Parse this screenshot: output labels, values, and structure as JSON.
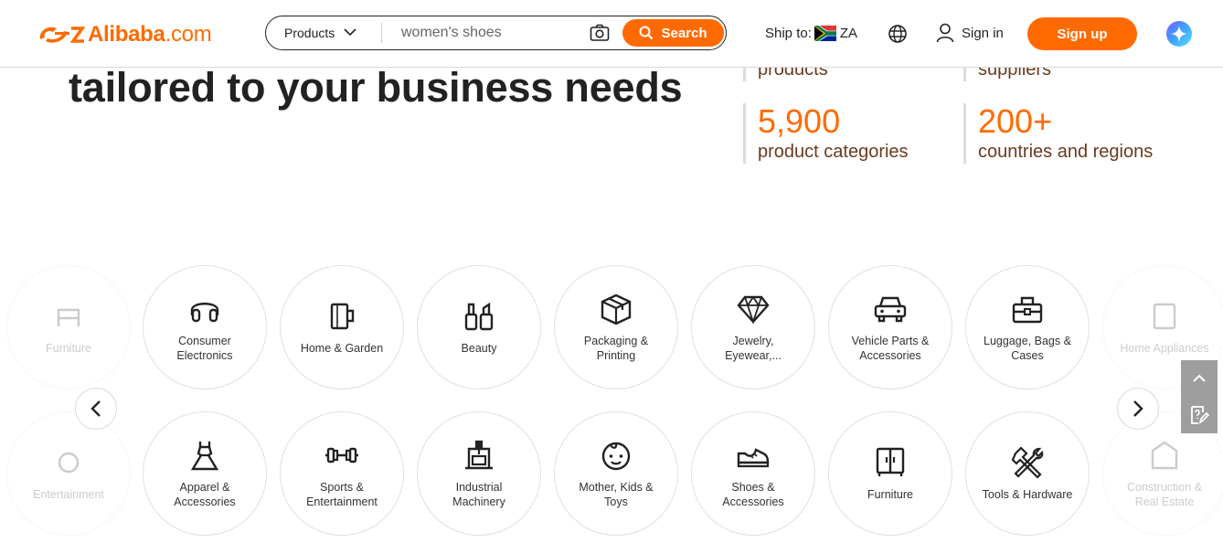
{
  "header": {
    "logo_text": "Alibaba",
    "logo_suffix": ".com",
    "search": {
      "category": "Products",
      "value": "women's shoes",
      "button_label": "Search"
    },
    "ship_to_label": "Ship to:",
    "ship_to_country": "ZA",
    "sign_in_label": "Sign in",
    "sign_up_label": "Sign up"
  },
  "hero": {
    "title": "tailored to your business needs",
    "stats": [
      {
        "number": "",
        "label": "products"
      },
      {
        "number": "",
        "label": "suppliers"
      },
      {
        "number": "5,900",
        "label": "product categories"
      },
      {
        "number": "200+",
        "label": "countries and regions"
      }
    ]
  },
  "categories": {
    "row1": [
      {
        "label": "Furniture",
        "icon": "furniture-icon"
      },
      {
        "label": "Consumer Electronics",
        "icon": "headphones-icon"
      },
      {
        "label": "Home & Garden",
        "icon": "mug-icon"
      },
      {
        "label": "Beauty",
        "icon": "cosmetics-icon"
      },
      {
        "label": "Packaging & Printing",
        "icon": "box-icon"
      },
      {
        "label": "Jewelry, Eyewear,...",
        "icon": "diamond-icon"
      },
      {
        "label": "Vehicle Parts & Accessories",
        "icon": "car-icon"
      },
      {
        "label": "Luggage, Bags & Cases",
        "icon": "bag-icon"
      },
      {
        "label": "Home Appliances",
        "icon": "appliance-icon"
      }
    ],
    "row2": [
      {
        "label": "Entertainment",
        "icon": "entertainment-icon"
      },
      {
        "label": "Apparel & Accessories",
        "icon": "dress-icon"
      },
      {
        "label": "Sports & Entertainment",
        "icon": "dumbbell-icon"
      },
      {
        "label": "Industrial Machinery",
        "icon": "machine-icon"
      },
      {
        "label": "Mother, Kids & Toys",
        "icon": "baby-face-icon"
      },
      {
        "label": "Shoes & Accessories",
        "icon": "shoe-icon"
      },
      {
        "label": "Furniture",
        "icon": "cabinet-icon"
      },
      {
        "label": "Tools & Hardware",
        "icon": "tools-icon"
      },
      {
        "label": "Construction & Real Estate",
        "icon": "construction-icon"
      }
    ]
  },
  "colors": {
    "brand": "#ff6a00",
    "stat_label": "#6b3a1f",
    "side_tools": "#9e9e9e"
  }
}
